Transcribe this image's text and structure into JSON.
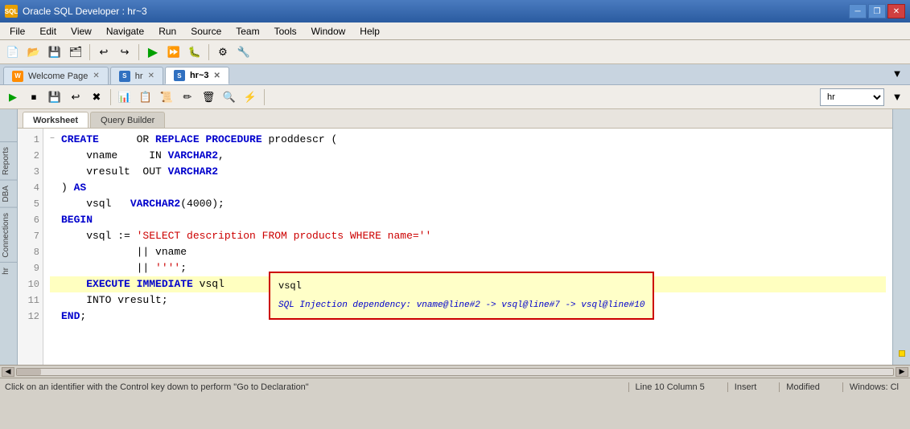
{
  "window": {
    "title": "Oracle SQL Developer : hr~3",
    "icon_label": "ORA"
  },
  "menu": {
    "items": [
      "File",
      "Edit",
      "View",
      "Navigate",
      "Run",
      "Source",
      "Team",
      "Tools",
      "Window",
      "Help"
    ]
  },
  "doc_tabs": [
    {
      "id": "welcome",
      "label": "Welcome Page",
      "icon_type": "orange",
      "active": false
    },
    {
      "id": "hr",
      "label": "hr",
      "icon_type": "blue",
      "active": false
    },
    {
      "id": "hr3",
      "label": "hr~3",
      "icon_type": "blue",
      "active": true
    }
  ],
  "worksheet_tabs": [
    {
      "id": "worksheet",
      "label": "Worksheet",
      "active": true
    },
    {
      "id": "querybuilder",
      "label": "Query Builder",
      "active": false
    }
  ],
  "connection": {
    "label": "hr",
    "options": [
      "hr"
    ]
  },
  "code": {
    "lines": [
      {
        "num": 1,
        "fold": "−",
        "tokens": [
          {
            "t": "kw",
            "v": "CREATE"
          },
          {
            "t": "plain",
            "v": "     OR "
          },
          {
            "t": "kw",
            "v": "REPLACE"
          },
          {
            "t": "plain",
            "v": " "
          },
          {
            "t": "kw",
            "v": "PROCEDURE"
          },
          {
            "t": "plain",
            "v": " proddescr ("
          }
        ]
      },
      {
        "num": 2,
        "fold": " ",
        "tokens": [
          {
            "t": "plain",
            "v": "    vname     IN "
          },
          {
            "t": "kw",
            "v": "VARCHAR2"
          },
          {
            "t": "plain",
            "v": ","
          }
        ]
      },
      {
        "num": 3,
        "fold": " ",
        "tokens": [
          {
            "t": "plain",
            "v": "    vresult  OUT "
          },
          {
            "t": "kw",
            "v": "VARCHAR2"
          }
        ]
      },
      {
        "num": 4,
        "fold": " ",
        "tokens": [
          {
            "t": "plain",
            "v": ") "
          },
          {
            "t": "kw",
            "v": "AS"
          }
        ]
      },
      {
        "num": 5,
        "fold": " ",
        "tokens": [
          {
            "t": "plain",
            "v": "    vsql   "
          },
          {
            "t": "kw",
            "v": "VARCHAR2"
          },
          {
            "t": "plain",
            "v": "(4000);"
          }
        ]
      },
      {
        "num": 6,
        "fold": " ",
        "tokens": [
          {
            "t": "kw",
            "v": "BEGIN"
          }
        ]
      },
      {
        "num": 7,
        "fold": " ",
        "tokens": [
          {
            "t": "plain",
            "v": "    vsql := "
          },
          {
            "t": "str",
            "v": "'SELECT description FROM products WHERE name=''"
          },
          {
            "t": "plain",
            "v": ""
          }
        ]
      },
      {
        "num": 8,
        "fold": " ",
        "tokens": [
          {
            "t": "plain",
            "v": "            || vname"
          }
        ]
      },
      {
        "num": 9,
        "fold": " ",
        "tokens": [
          {
            "t": "plain",
            "v": "            || "
          },
          {
            "t": "str",
            "v": "''''"
          },
          {
            "t": "plain",
            "v": ";"
          }
        ]
      },
      {
        "num": 10,
        "fold": " ",
        "tokens": [
          {
            "t": "plain",
            "v": "    "
          },
          {
            "t": "kw",
            "v": "EXECUTE"
          },
          {
            "t": "plain",
            "v": " "
          },
          {
            "t": "kw",
            "v": "IMMEDIATE"
          },
          {
            "t": "plain",
            "v": " vsql"
          }
        ],
        "highlight": true
      },
      {
        "num": 11,
        "fold": " ",
        "tokens": [
          {
            "t": "plain",
            "v": "    INTO vresult;"
          }
        ]
      },
      {
        "num": 12,
        "fold": " ",
        "tokens": [
          {
            "t": "kw",
            "v": "END"
          },
          {
            "t": "plain",
            "v": ";"
          }
        ]
      }
    ]
  },
  "tooltip": {
    "line1": "vsql",
    "line2": "SQL Injection dependency: vname@line#2 -> vsql@line#7 -> vsql@line#10"
  },
  "status": {
    "left": "Click on an identifier with the Control key down to perform \"Go to Declaration\"",
    "line": "Line 10 Column 5",
    "mode": "Insert",
    "modified": "Modified",
    "os": "Windows: Cl"
  },
  "toolbar_main": {
    "buttons": [
      "📁",
      "💾",
      "📋",
      "↩",
      "↪",
      "▶",
      "⏩",
      "⚙",
      "🔧"
    ]
  },
  "toolbar_sql": {
    "buttons": [
      "▶",
      "⏹",
      "📋",
      "⬆",
      "⬇",
      "📄",
      "✏",
      "🔍",
      "⚡"
    ]
  }
}
